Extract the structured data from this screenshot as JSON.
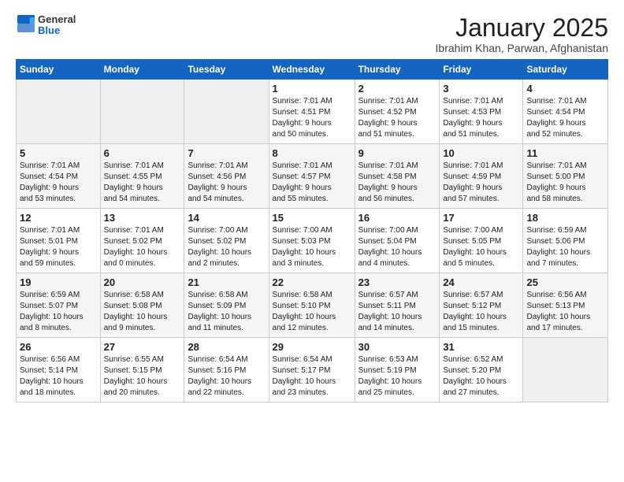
{
  "header": {
    "logo_general": "General",
    "logo_blue": "Blue",
    "month_title": "January 2025",
    "subtitle": "Ibrahim Khan, Parwan, Afghanistan"
  },
  "days_of_week": [
    "Sunday",
    "Monday",
    "Tuesday",
    "Wednesday",
    "Thursday",
    "Friday",
    "Saturday"
  ],
  "weeks": [
    [
      {
        "day": "",
        "info": ""
      },
      {
        "day": "",
        "info": ""
      },
      {
        "day": "",
        "info": ""
      },
      {
        "day": "1",
        "info": "Sunrise: 7:01 AM\nSunset: 4:51 PM\nDaylight: 9 hours\nand 50 minutes."
      },
      {
        "day": "2",
        "info": "Sunrise: 7:01 AM\nSunset: 4:52 PM\nDaylight: 9 hours\nand 51 minutes."
      },
      {
        "day": "3",
        "info": "Sunrise: 7:01 AM\nSunset: 4:53 PM\nDaylight: 9 hours\nand 51 minutes."
      },
      {
        "day": "4",
        "info": "Sunrise: 7:01 AM\nSunset: 4:54 PM\nDaylight: 9 hours\nand 52 minutes."
      }
    ],
    [
      {
        "day": "5",
        "info": "Sunrise: 7:01 AM\nSunset: 4:54 PM\nDaylight: 9 hours\nand 53 minutes."
      },
      {
        "day": "6",
        "info": "Sunrise: 7:01 AM\nSunset: 4:55 PM\nDaylight: 9 hours\nand 54 minutes."
      },
      {
        "day": "7",
        "info": "Sunrise: 7:01 AM\nSunset: 4:56 PM\nDaylight: 9 hours\nand 54 minutes."
      },
      {
        "day": "8",
        "info": "Sunrise: 7:01 AM\nSunset: 4:57 PM\nDaylight: 9 hours\nand 55 minutes."
      },
      {
        "day": "9",
        "info": "Sunrise: 7:01 AM\nSunset: 4:58 PM\nDaylight: 9 hours\nand 56 minutes."
      },
      {
        "day": "10",
        "info": "Sunrise: 7:01 AM\nSunset: 4:59 PM\nDaylight: 9 hours\nand 57 minutes."
      },
      {
        "day": "11",
        "info": "Sunrise: 7:01 AM\nSunset: 5:00 PM\nDaylight: 9 hours\nand 58 minutes."
      }
    ],
    [
      {
        "day": "12",
        "info": "Sunrise: 7:01 AM\nSunset: 5:01 PM\nDaylight: 9 hours\nand 59 minutes."
      },
      {
        "day": "13",
        "info": "Sunrise: 7:01 AM\nSunset: 5:02 PM\nDaylight: 10 hours\nand 0 minutes."
      },
      {
        "day": "14",
        "info": "Sunrise: 7:00 AM\nSunset: 5:02 PM\nDaylight: 10 hours\nand 2 minutes."
      },
      {
        "day": "15",
        "info": "Sunrise: 7:00 AM\nSunset: 5:03 PM\nDaylight: 10 hours\nand 3 minutes."
      },
      {
        "day": "16",
        "info": "Sunrise: 7:00 AM\nSunset: 5:04 PM\nDaylight: 10 hours\nand 4 minutes."
      },
      {
        "day": "17",
        "info": "Sunrise: 7:00 AM\nSunset: 5:05 PM\nDaylight: 10 hours\nand 5 minutes."
      },
      {
        "day": "18",
        "info": "Sunrise: 6:59 AM\nSunset: 5:06 PM\nDaylight: 10 hours\nand 7 minutes."
      }
    ],
    [
      {
        "day": "19",
        "info": "Sunrise: 6:59 AM\nSunset: 5:07 PM\nDaylight: 10 hours\nand 8 minutes."
      },
      {
        "day": "20",
        "info": "Sunrise: 6:58 AM\nSunset: 5:08 PM\nDaylight: 10 hours\nand 9 minutes."
      },
      {
        "day": "21",
        "info": "Sunrise: 6:58 AM\nSunset: 5:09 PM\nDaylight: 10 hours\nand 11 minutes."
      },
      {
        "day": "22",
        "info": "Sunrise: 6:58 AM\nSunset: 5:10 PM\nDaylight: 10 hours\nand 12 minutes."
      },
      {
        "day": "23",
        "info": "Sunrise: 6:57 AM\nSunset: 5:11 PM\nDaylight: 10 hours\nand 14 minutes."
      },
      {
        "day": "24",
        "info": "Sunrise: 6:57 AM\nSunset: 5:12 PM\nDaylight: 10 hours\nand 15 minutes."
      },
      {
        "day": "25",
        "info": "Sunrise: 6:56 AM\nSunset: 5:13 PM\nDaylight: 10 hours\nand 17 minutes."
      }
    ],
    [
      {
        "day": "26",
        "info": "Sunrise: 6:56 AM\nSunset: 5:14 PM\nDaylight: 10 hours\nand 18 minutes."
      },
      {
        "day": "27",
        "info": "Sunrise: 6:55 AM\nSunset: 5:15 PM\nDaylight: 10 hours\nand 20 minutes."
      },
      {
        "day": "28",
        "info": "Sunrise: 6:54 AM\nSunset: 5:16 PM\nDaylight: 10 hours\nand 22 minutes."
      },
      {
        "day": "29",
        "info": "Sunrise: 6:54 AM\nSunset: 5:17 PM\nDaylight: 10 hours\nand 23 minutes."
      },
      {
        "day": "30",
        "info": "Sunrise: 6:53 AM\nSunset: 5:19 PM\nDaylight: 10 hours\nand 25 minutes."
      },
      {
        "day": "31",
        "info": "Sunrise: 6:52 AM\nSunset: 5:20 PM\nDaylight: 10 hours\nand 27 minutes."
      },
      {
        "day": "",
        "info": ""
      }
    ]
  ]
}
